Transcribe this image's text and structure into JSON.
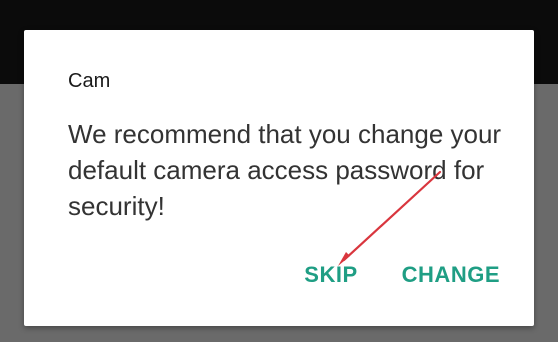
{
  "dialog": {
    "title": "Cam",
    "message": "We recommend that you change your default camera access password for security!",
    "buttons": {
      "skip": "SKIP",
      "change": "CHANGE"
    }
  },
  "colors": {
    "accent": "#1f9e84",
    "annotation_arrow": "#d9363e",
    "status_bar": "#0b0b0b",
    "scrim": "#6a6a6a",
    "dialog_bg": "#ffffff"
  },
  "annotation": {
    "icon": "red-arrow-icon",
    "points_to": "skip"
  }
}
